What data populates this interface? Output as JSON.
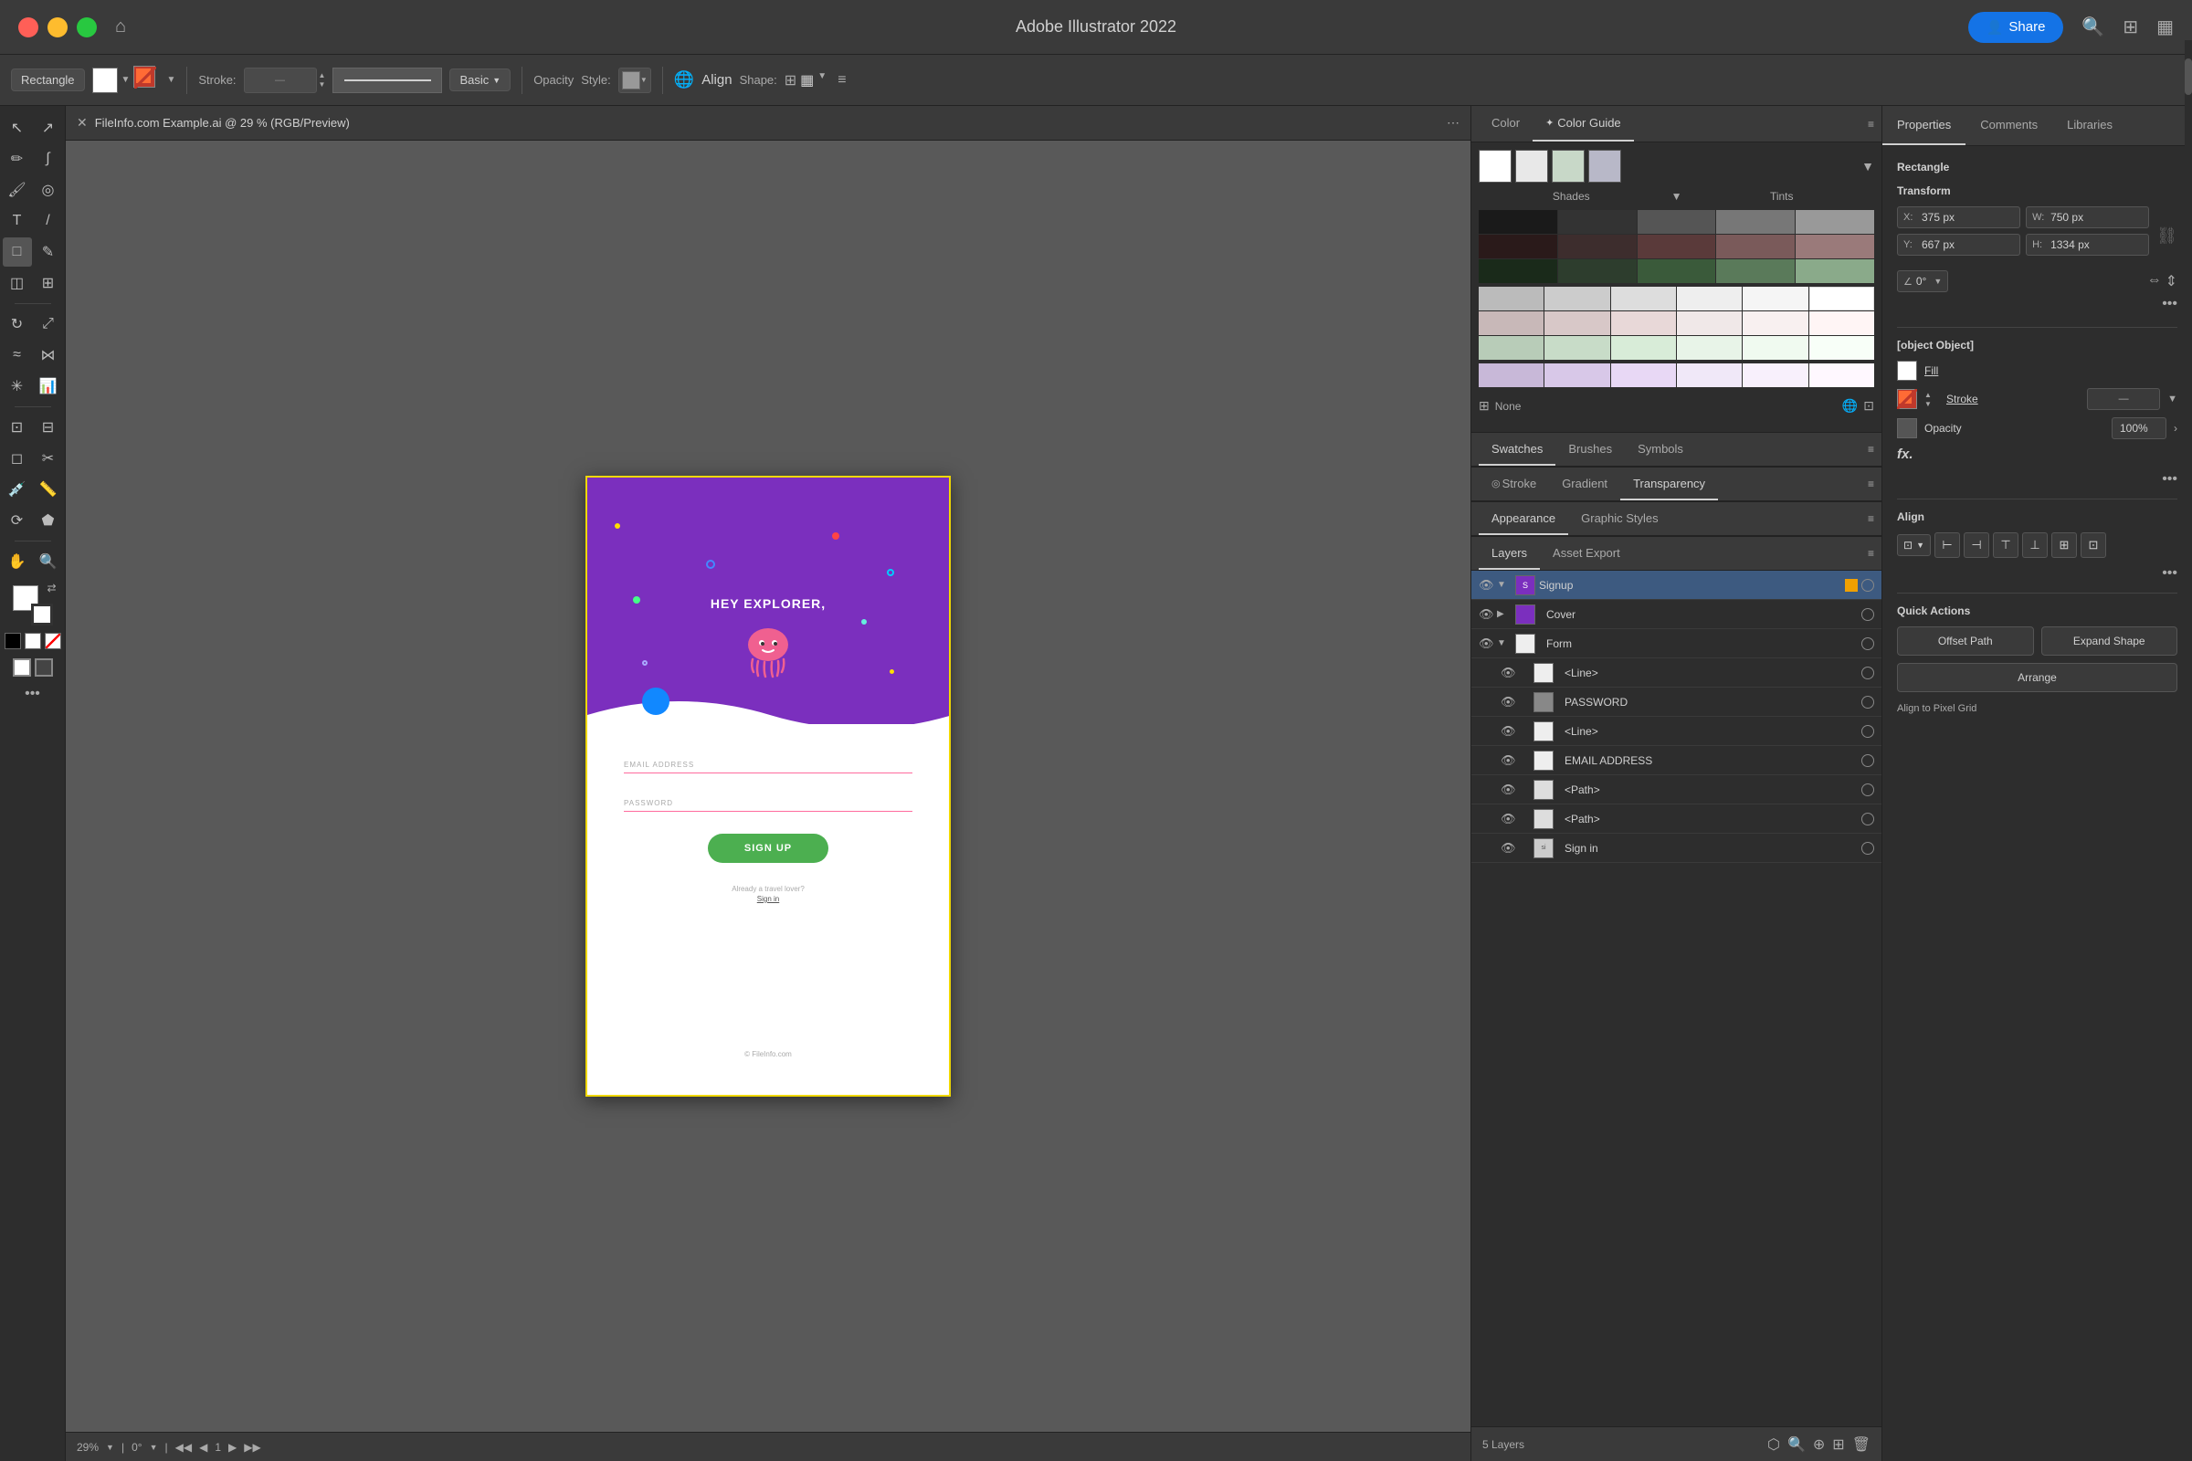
{
  "app": {
    "title": "Adobe Illustrator 2022",
    "share_label": "Share"
  },
  "titlebar": {
    "traffic_lights": [
      "red",
      "yellow",
      "green"
    ],
    "home_icon": "⌂"
  },
  "toolbar": {
    "tool_name": "Rectangle",
    "fill_label": "Fill",
    "stroke_label": "Stroke:",
    "opacity_label": "Opacity",
    "style_label": "Style:",
    "basic_label": "Basic",
    "align_label": "Align",
    "shape_label": "Shape:"
  },
  "canvas": {
    "tab_title": "FileInfo.com Example.ai @ 29 % (RGB/Preview)",
    "zoom": "29%",
    "rotation": "0°",
    "page": "1",
    "watermark": "© FileInfo.com",
    "artboard": {
      "hey_text": "HEY EXPLORER,",
      "email_label": "EMAIL ADDRESS",
      "password_label": "PASSWORD",
      "signup_btn": "SIGN UP",
      "already_text": "Already a travel lover?",
      "signin_link": "Sign in"
    }
  },
  "middle_panel": {
    "color_tab": "Color",
    "color_guide_tab": "Color Guide",
    "shades_label": "Shades",
    "tints_label": "Tints",
    "none_label": "None",
    "swatches_tab": "Swatches",
    "brushes_tab": "Brushes",
    "symbols_tab": "Symbols",
    "stroke_tab": "Stroke",
    "gradient_tab": "Gradient",
    "transparency_tab": "Transparency",
    "appearance_tab": "Appearance",
    "graphic_styles_tab": "Graphic Styles",
    "layers_tab": "Layers",
    "asset_export_tab": "Asset Export",
    "layers_count": "5 Layers",
    "layers": [
      {
        "name": "Signup",
        "indent": 0,
        "selected": true,
        "has_expand": true,
        "has_color": true
      },
      {
        "name": "Cover",
        "indent": 1,
        "selected": false,
        "has_expand": true
      },
      {
        "name": "Form",
        "indent": 1,
        "selected": false,
        "has_expand": true
      },
      {
        "name": "<Line>",
        "indent": 2,
        "selected": false
      },
      {
        "name": "PASSWORD",
        "indent": 2,
        "selected": false
      },
      {
        "name": "<Line>",
        "indent": 2,
        "selected": false
      },
      {
        "name": "EMAIL ADDRESS",
        "indent": 2,
        "selected": false
      },
      {
        "name": "<Path>",
        "indent": 2,
        "selected": false
      },
      {
        "name": "<Path>",
        "indent": 2,
        "selected": false
      },
      {
        "name": "Sign in",
        "indent": 2,
        "selected": false
      }
    ]
  },
  "properties_panel": {
    "properties_tab": "Properties",
    "comments_tab": "Comments",
    "libraries_tab": "Libraries",
    "panel_title": "Rectangle",
    "transform": {
      "x_label": "X:",
      "x_value": "375 px",
      "y_label": "Y:",
      "y_value": "667 px",
      "w_label": "W:",
      "w_value": "750 px",
      "h_label": "H:",
      "h_value": "1334 px",
      "angle_label": "∠",
      "angle_value": "0°"
    },
    "appearance": {
      "fill_label": "Fill",
      "stroke_label": "Stroke",
      "opacity_label": "Opacity",
      "opacity_value": "100%"
    },
    "fx_label": "fx.",
    "align_title": "Align",
    "quick_actions_title": "Quick Actions",
    "offset_path_btn": "Offset Path",
    "expand_shape_btn": "Expand Shape",
    "arrange_btn": "Arrange",
    "align_pixel_label": "Align to Pixel Grid"
  }
}
